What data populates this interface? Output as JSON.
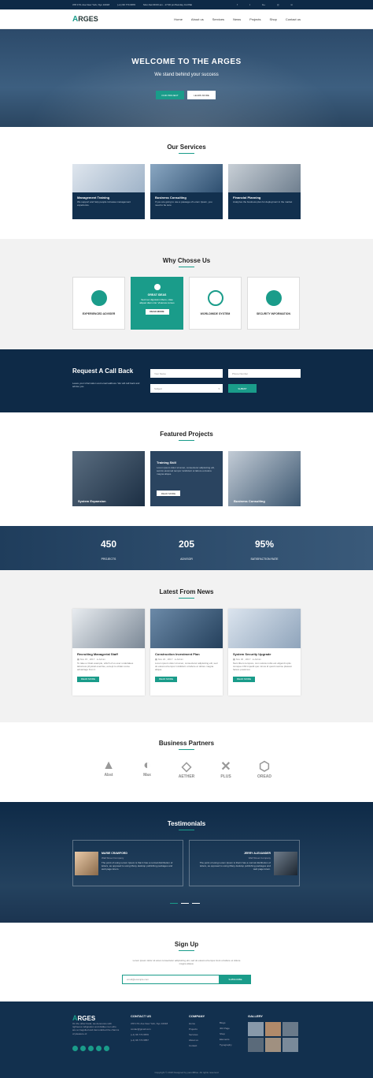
{
  "topbar": {
    "address": "378 17/1 Ave New York, Nyo 10018",
    "phone": "(+1) 96 774 6870",
    "hours": "Mon-Sat 09:00 am - 17:00 pm/Sunday CLOSE"
  },
  "brand": {
    "logo_a": "A",
    "logo_rest": "RGES"
  },
  "nav": [
    "Home",
    "About us",
    "Services",
    "News",
    "Projects",
    "Shop",
    "Contact us"
  ],
  "hero": {
    "title": "WELCOME TO THE ARGES",
    "subtitle": "We stand behind your success",
    "btn_primary": "OUR PROJECT",
    "btn_secondary": "LEARN MORE"
  },
  "services": {
    "title": "Our Services",
    "items": [
      {
        "title": "Management Training",
        "text": "We support and help people increase management experience."
      },
      {
        "title": "Business Consulting",
        "text": "If you are going to use a passage of Lorem Ipsum, you need to be sure"
      },
      {
        "title": "Financial Planning",
        "text": "Analyzes the business plan for deployment in the market"
      }
    ]
  },
  "why": {
    "title": "Why Chosse Us",
    "items": [
      "EXPERIENCED ADVISER",
      "GREAT IDEAS",
      "WORLDWIDE SYSTEM",
      "SECURITY INFORMATION"
    ],
    "highlight_text": "Sed nec dignissim libero, vitae aliquet diam nisi. Vivamus cursus",
    "highlight_btn": "READ MORE"
  },
  "callback": {
    "title": "Request A Call Back",
    "text": "Leave your information and email address. We will call back and advise you.",
    "name_ph": "Your Name",
    "phone_ph": "Phone Number",
    "subject": "Subject",
    "submit": "SUBMIT"
  },
  "projects": {
    "title": "Featured Projects",
    "items": [
      "System Expansion",
      "Training Skill",
      "Business Consulting"
    ],
    "overlay_text": "Lorem ipsum dolor sit amet, consectetur adipisicing elit, sed do eiusmod tempor incididunt ut labore et dolore magna aliqua.",
    "overlay_btn": "READ MORE"
  },
  "stats": [
    {
      "value": "450",
      "label": "PROJECTS"
    },
    {
      "value": "205",
      "label": "ADVISOR"
    },
    {
      "value": "95%",
      "label": "SATISFACTION RATE"
    }
  ],
  "news": {
    "title": "Latest From News",
    "read_more": "READ MORE",
    "items": [
      {
        "title": "Recruiting Managerial Staff",
        "date": "Nov 15 , 2017",
        "author": "Admin",
        "text": "To take a trivial example, which of us ever undertakes laborious physical exercise, except to obtain some advantage from it"
      },
      {
        "title": "Construction Investment Plan",
        "date": "Nov 22 , 2017",
        "author": "Admin",
        "text": "Lorem ipsum dolor sit amet, consectetur adipisicing elit, sed do eiusmod tempor incididunt ut labore et dolore magna aliqua."
      },
      {
        "title": "System Security Upgrade",
        "date": "Nov 30 , 2017",
        "author": "Admin",
        "text": "Nam libero tempore, cum soluta nobis est eligendi optio cumque nihil impedit quo minus id quod maxime placeat facere possimus"
      }
    ]
  },
  "partners": {
    "title": "Business Partners",
    "items": [
      "Abst",
      "Max",
      "AETHER",
      "PLUS",
      "OREAD"
    ]
  },
  "testimonials": {
    "title": "Testimonials",
    "items": [
      {
        "name": "MARIE CRAWFORD",
        "company": "Wall Street Company",
        "text": "The point of using Lorem Ipsum is that it has a normal distribution of letters, as opposed to using Many desktop publishing packages and web page lorem."
      },
      {
        "name": "JERRY ALEXANDER",
        "company": "Wall Street Company",
        "text": "The point of using Lorem Ipsum is that it has a normal distribution of letters, as opposed to using Many desktop publishing packages and web page lorem."
      }
    ]
  },
  "signup": {
    "title": "Sign Up",
    "text": "Lorem ipsum dolor sit amet consectetur adipisicing elit, sed do eiusmod tempor dunt ut labore et dolore magna aliqua.",
    "placeholder": "email@example.com",
    "button": "SUBSCRIBE"
  },
  "footer": {
    "about": "On the other hand, we denounce with righteous indignation and dislike men who are so beguiled and demoralized the charms of pleasure of.",
    "contact_title": "CONTACT US",
    "contact": [
      "378 17/1 Ave New York, Nyo 10018",
      "contac@gmail.com",
      "(+1) 96 774 6870",
      "(+1) 96 774 6857"
    ],
    "company_title": "COMPANY",
    "company": [
      "Home",
      "Projects",
      "Services",
      "About us",
      "Contact"
    ],
    "links": [
      "Blogs",
      "404 Page",
      "Shop",
      "Elements",
      "Typography"
    ],
    "gallery_title": "GALLERY",
    "copyright": "Copyright © 2018 Designed by pencilBlue. All rights reserved"
  },
  "colors": {
    "accent": "#1a9c8a",
    "navy": "#12304e",
    "dark": "#0e2a47"
  }
}
